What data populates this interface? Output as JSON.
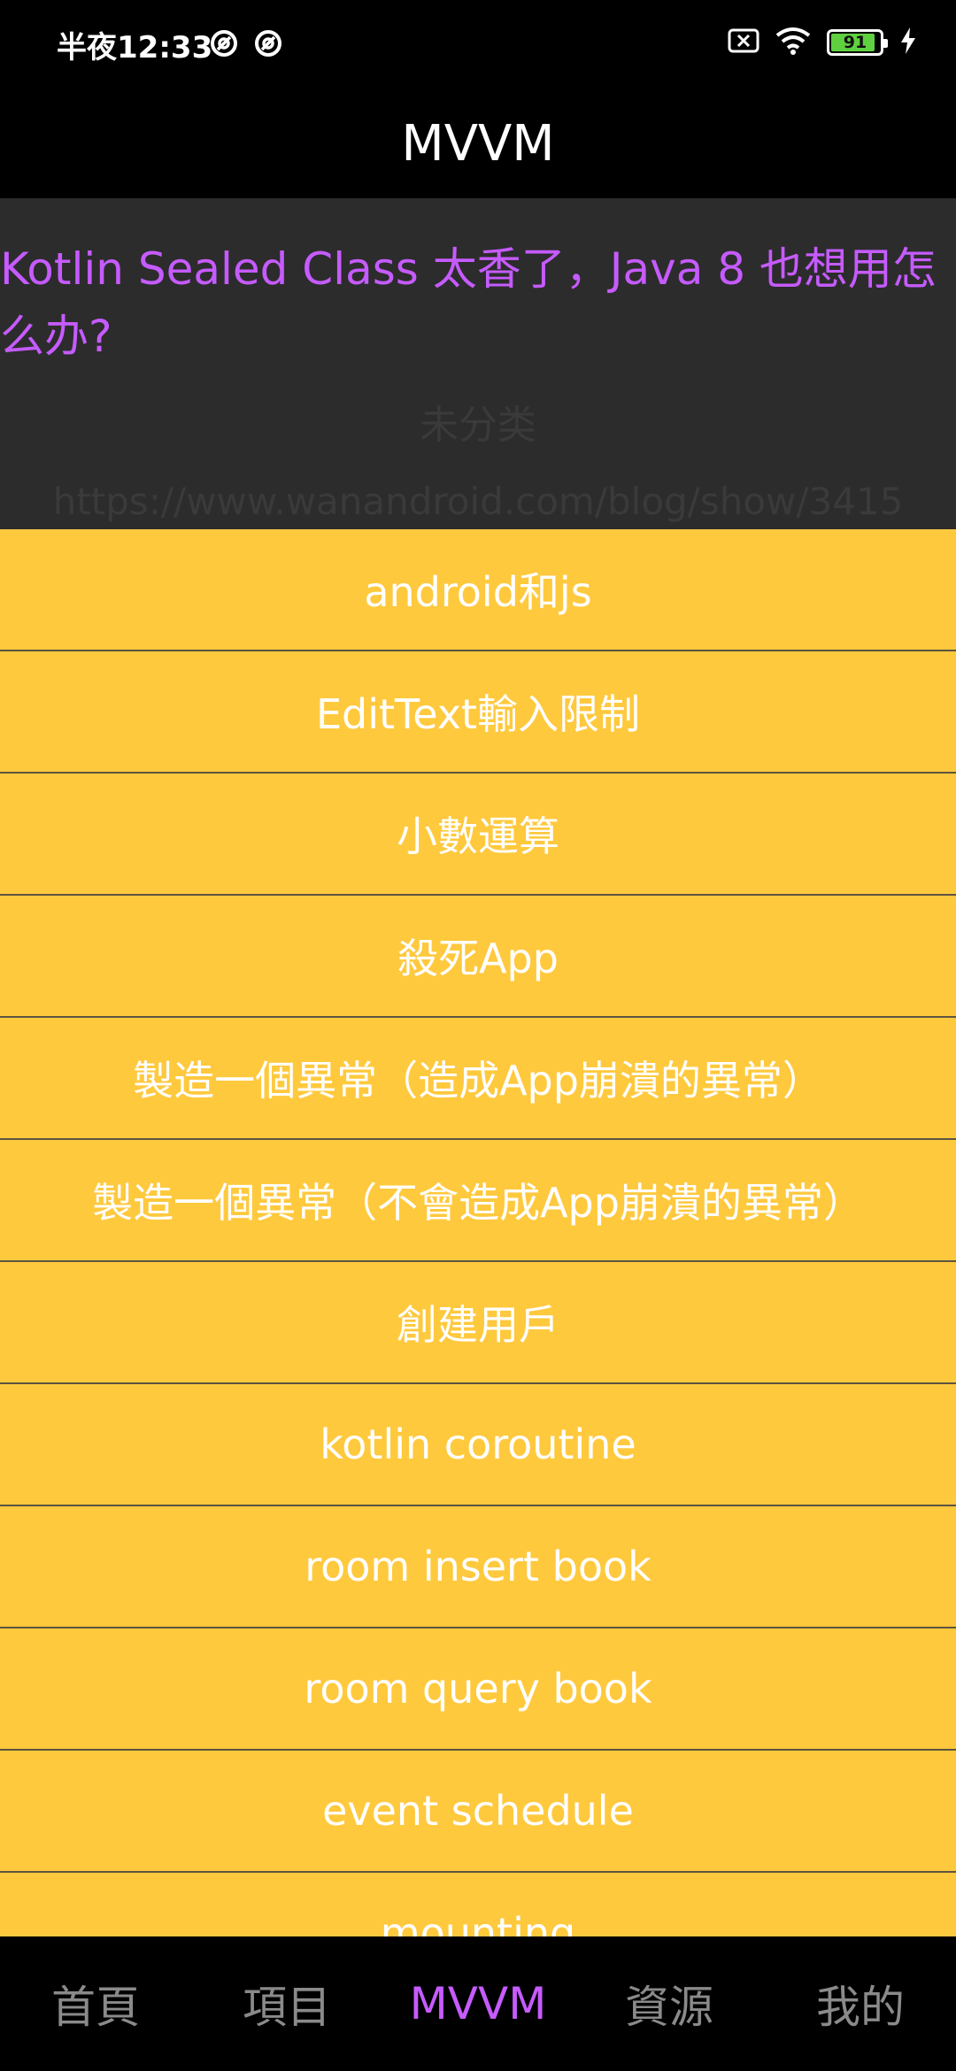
{
  "status_bar": {
    "time": "半夜12:33",
    "battery_level": "91",
    "battery_fraction": 0.91,
    "icons": [
      "at-sign-icon",
      "at-sign-icon",
      "sim-off-icon",
      "wifi-icon",
      "battery-icon",
      "charging-bolt-icon"
    ]
  },
  "app_bar": {
    "title": "MVVM"
  },
  "article": {
    "title": "Kotlin Sealed Class 太香了，Java 8 也想用怎么办?",
    "category": "未分类",
    "link": "https://www.wanandroid.com/blog/show/3415"
  },
  "menu": {
    "items": [
      {
        "label": "android和js"
      },
      {
        "label": "EditText輸入限制"
      },
      {
        "label": "小數運算"
      },
      {
        "label": "殺死App"
      },
      {
        "label": "製造一個異常（造成App崩潰的異常）"
      },
      {
        "label": "製造一個異常（不會造成App崩潰的異常）"
      },
      {
        "label": "創建用戶"
      },
      {
        "label": "kotlin coroutine"
      },
      {
        "label": "room insert book"
      },
      {
        "label": "room query book"
      },
      {
        "label": "event schedule"
      },
      {
        "label": "mounting"
      }
    ]
  },
  "bottom_nav": {
    "items": [
      {
        "label": "首頁",
        "active": false
      },
      {
        "label": "項目",
        "active": false
      },
      {
        "label": "MVVM",
        "active": true
      },
      {
        "label": "資源",
        "active": false
      },
      {
        "label": "我的",
        "active": false
      }
    ]
  },
  "colors": {
    "accent": "#c65bff",
    "menu_background": "#ffc93e",
    "card_background": "#2c2c2c",
    "nav_inactive": "#8a8a8a",
    "battery_green": "#5fd140"
  }
}
